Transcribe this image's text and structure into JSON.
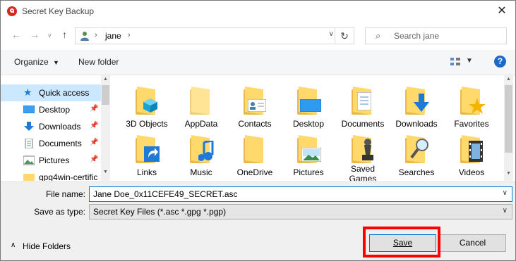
{
  "window": {
    "title": "Secret Key Backup"
  },
  "address": {
    "crumb": "jane"
  },
  "search": {
    "placeholder": "Search jane"
  },
  "toolbar": {
    "organize": "Organize",
    "new_folder": "New folder",
    "help": "?"
  },
  "nav_pane": {
    "items": [
      {
        "label": "Quick access",
        "icon": "star-icon"
      },
      {
        "label": "Desktop",
        "icon": "desktop-icon",
        "pinned": true
      },
      {
        "label": "Downloads",
        "icon": "download-icon",
        "pinned": true
      },
      {
        "label": "Documents",
        "icon": "document-icon",
        "pinned": true
      },
      {
        "label": "Pictures",
        "icon": "picture-icon",
        "pinned": true
      },
      {
        "label": "gpg4win-certific",
        "icon": "folder-icon"
      }
    ]
  },
  "folders": {
    "row1": [
      "3D Objects",
      "AppData",
      "Contacts",
      "Desktop",
      "Documents",
      "Downloads",
      "Favorites"
    ],
    "row2": [
      "Links",
      "Music",
      "OneDrive",
      "Pictures",
      "Saved Games",
      "Searches",
      "Videos"
    ]
  },
  "form": {
    "file_name_label": "File name:",
    "file_name_value": "Jane Doe_0x11CEFE49_SECRET.asc",
    "save_type_label": "Save as type:",
    "save_type_value": "Secret Key Files (*.asc *.gpg *.pgp)"
  },
  "footer": {
    "hide_folders": "Hide Folders",
    "save": "Save",
    "cancel": "Cancel"
  },
  "colors": {
    "highlight": "#ff0000",
    "selection": "#cce8ff",
    "accent": "#0078d7"
  }
}
